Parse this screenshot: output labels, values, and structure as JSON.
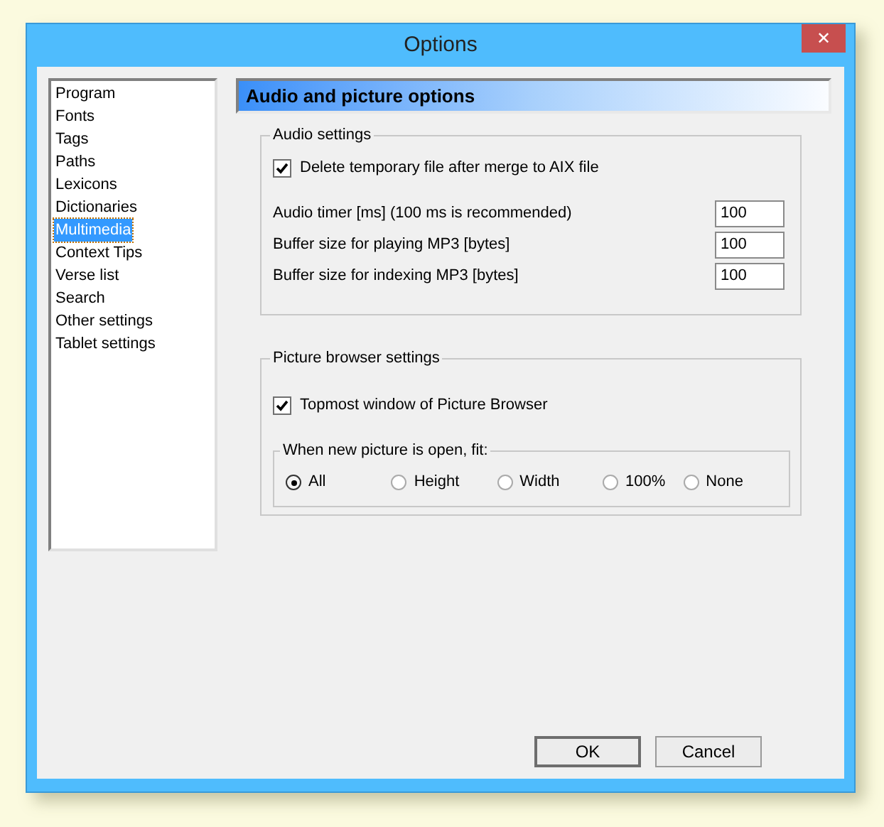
{
  "window": {
    "title": "Options",
    "close": "✕"
  },
  "sidebar": {
    "items": [
      {
        "label": "Program",
        "selected": false
      },
      {
        "label": "Fonts",
        "selected": false
      },
      {
        "label": "Tags",
        "selected": false
      },
      {
        "label": "Paths",
        "selected": false
      },
      {
        "label": "Lexicons",
        "selected": false
      },
      {
        "label": "Dictionaries",
        "selected": false
      },
      {
        "label": "Multimedia",
        "selected": true
      },
      {
        "label": "Context Tips",
        "selected": false
      },
      {
        "label": "Verse list",
        "selected": false
      },
      {
        "label": "Search",
        "selected": false
      },
      {
        "label": "Other settings",
        "selected": false
      },
      {
        "label": "Tablet settings",
        "selected": false
      }
    ]
  },
  "header": "Audio and picture options",
  "audio": {
    "title": "Audio settings",
    "checkbox": {
      "label": "Delete temporary file after merge to AIX file",
      "checked": true
    },
    "fields": [
      {
        "label": "Audio timer [ms] (100 ms is recommended)",
        "value": "100"
      },
      {
        "label": "Buffer size for playing MP3 [bytes]",
        "value": "100"
      },
      {
        "label": "Buffer size for indexing MP3 [bytes]",
        "value": "100"
      }
    ]
  },
  "picture": {
    "title": "Picture browser settings",
    "checkbox": {
      "label": "Topmost window of Picture Browser",
      "checked": true
    },
    "fit": {
      "title": "When new picture is open, fit:",
      "options": [
        {
          "label": "All",
          "selected": true
        },
        {
          "label": "Height",
          "selected": false
        },
        {
          "label": "Width",
          "selected": false
        },
        {
          "label": "100%",
          "selected": false
        },
        {
          "label": "None",
          "selected": false
        }
      ]
    }
  },
  "buttons": [
    "OK",
    "Cancel"
  ]
}
